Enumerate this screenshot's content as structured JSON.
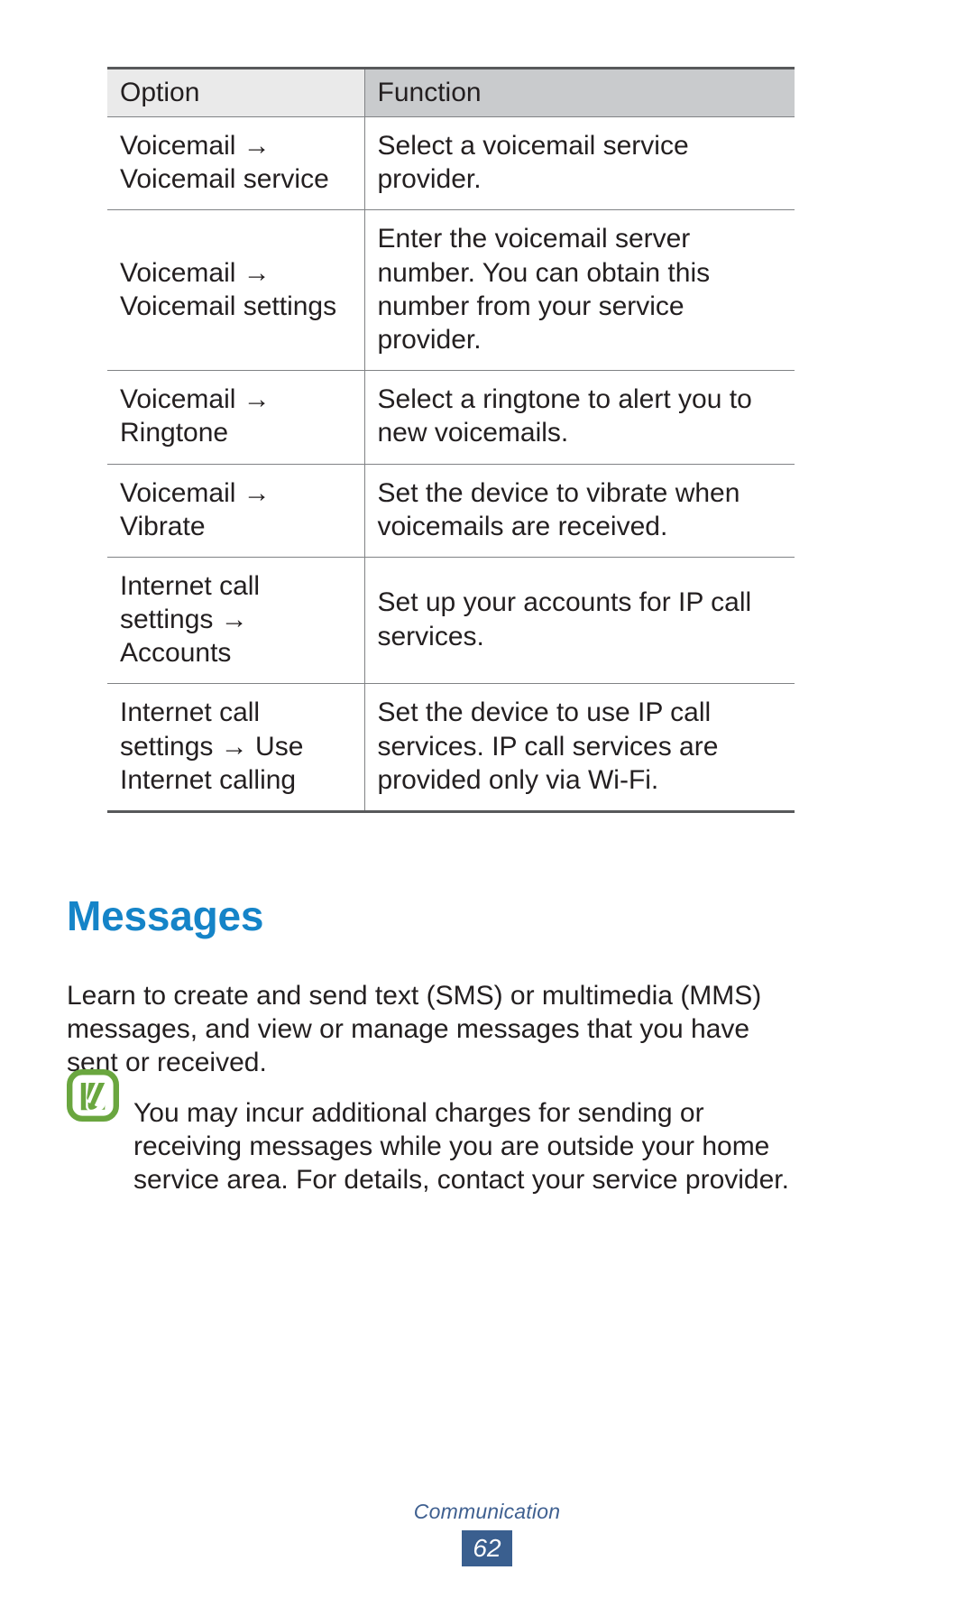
{
  "table": {
    "headers": [
      "Option",
      "Function"
    ],
    "rows": [
      {
        "option": "Voicemail → Voicemail service",
        "function": "Select a voicemail service provider."
      },
      {
        "option": "Voicemail → Voicemail settings",
        "function": "Enter the voicemail server number. You can obtain this number from your service provider."
      },
      {
        "option": "Voicemail → Ringtone",
        "function": "Select a ringtone to alert you to new voicemails."
      },
      {
        "option": "Voicemail → Vibrate",
        "function": "Set the device to vibrate when voicemails are received."
      },
      {
        "option": "Internet call settings → Accounts",
        "function": "Set up your accounts for IP call services."
      },
      {
        "option": "Internet call settings → Use Internet calling",
        "function": "Set the device to use IP call services. IP call services are provided only via Wi-Fi."
      }
    ]
  },
  "section": {
    "heading": "Messages",
    "intro": "Learn to create and send text (SMS) or multimedia (MMS) messages, and view or manage messages that you have sent or received.",
    "note": {
      "icon": "note-pencil-icon",
      "text": "You may incur additional charges for sending or receiving messages while you are outside your home service area. For details, contact your service provider."
    }
  },
  "footer": {
    "chapter": "Communication",
    "page_number": "62"
  },
  "colors": {
    "heading_blue": "#1584c8",
    "note_green": "#6aa63f",
    "footer_navy": "#3a5f8f",
    "header_option_bg": "#eaeaea",
    "header_function_bg": "#c9cbcd",
    "rule_dark": "#58595b",
    "rule_light": "#808285",
    "text": "#231f20"
  }
}
